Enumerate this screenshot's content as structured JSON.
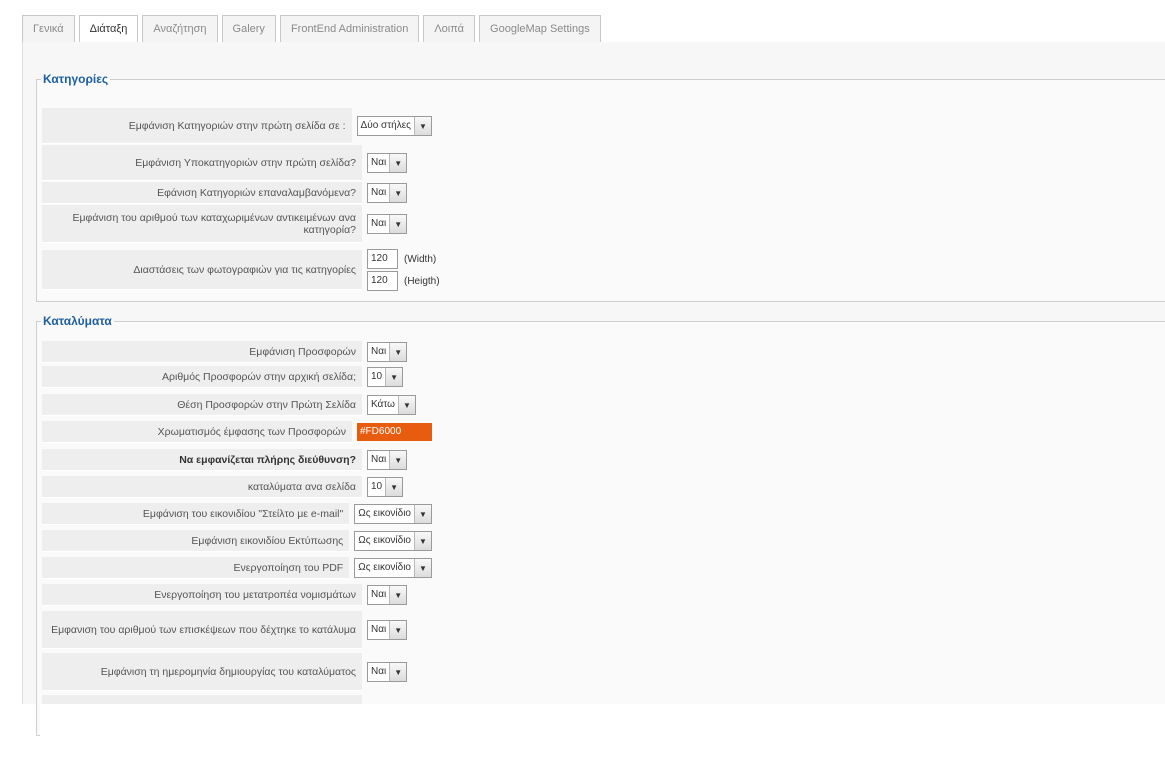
{
  "tabs": [
    {
      "label": "Γενικά",
      "active": false
    },
    {
      "label": "Διάταξη",
      "active": true
    },
    {
      "label": "Αναζήτηση",
      "active": false
    },
    {
      "label": "Galery",
      "active": false
    },
    {
      "label": "FrontEnd Administration",
      "active": false
    },
    {
      "label": "Λοιπά",
      "active": false
    },
    {
      "label": "GoogleMap Settings",
      "active": false
    }
  ],
  "categories": {
    "legend": "Κατηγορίες",
    "rows": [
      {
        "label": "Εμφάνιση Κατηγοριών στην πρώτη σελίδα σε :",
        "value": "Δύο στήλες"
      },
      {
        "label": "Εμφάνιση Υποκατηγοριών στην πρώτη σελίδα?",
        "value": "Ναι"
      },
      {
        "label": "Εφάνιση Κατηγοριών επαναλαμβανόμενα?",
        "value": "Ναι"
      },
      {
        "label": "Εμφάνιση του αριθμού των καταχωριμένων αντικειμένων ανα κατηγορία?",
        "value": "Ναι"
      }
    ],
    "photo": {
      "label": "Διαστάσεις των φωτογραφιών για τις κατηγορίες",
      "width": "120",
      "width_unit": "(Width)",
      "height": "120",
      "height_unit": "(Heigth)"
    }
  },
  "accommodations": {
    "legend": "Καταλύματα",
    "rows": [
      {
        "label": "Εμφάνιση Προσφορών",
        "value": "Ναι"
      },
      {
        "label": "Αριθμός Προσφορών στην αρχική σελίδα;",
        "value": "10"
      },
      {
        "label": "Θέση Προσφορών στην Πρώτη Σελίδα",
        "value": "Κάτω"
      },
      {
        "label": "Χρωματισμός έμφασης των Προσφορών",
        "color": "#FD6000"
      },
      {
        "label": "Να εμφανίζεται πλήρης διεύθυνση?",
        "value": "Ναι"
      },
      {
        "label": "καταλύματα ανα σελίδα",
        "value": "10"
      },
      {
        "label": "Εμφάνιση του εικονιδίου \"Στείλτο με e-mail\"",
        "value": "Ως εικονίδιο"
      },
      {
        "label": "Εμφάνιση εικονιδίου Εκτύπωσης",
        "value": "Ως εικονίδιο"
      },
      {
        "label": "Ενεργοποίηση του PDF",
        "value": "Ως εικονίδιο"
      },
      {
        "label": "Ενεργοποίηση του μετατροπέα νομισμάτων",
        "value": "Ναι"
      },
      {
        "label": "Εμφανιση του αριθμού των επισκέψεων που δέχτηκε το κατάλυμα",
        "value": "Ναι"
      },
      {
        "label": "Εμφάνιση τη ημερομηνία δημιουργίας του καταλύματος",
        "value": "Ναι"
      }
    ]
  },
  "icons": {
    "dropdown": "chevron-down-icon"
  },
  "colors": {
    "legend": "#1e5fa0",
    "accent_swatch": "#e85c10"
  }
}
